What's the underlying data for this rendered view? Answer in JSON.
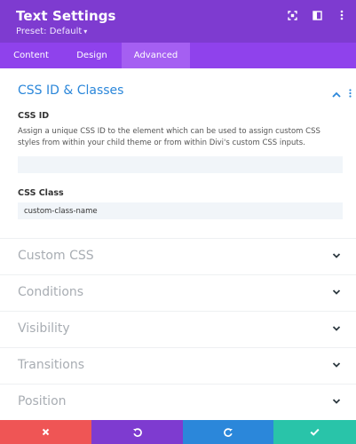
{
  "header": {
    "title": "Text Settings",
    "preset_label": "Preset: Default",
    "icons": [
      "expand-icon",
      "sidebar-toggle-icon",
      "more-options-icon"
    ],
    "color": "#7e3bd0"
  },
  "tabs": [
    {
      "label": "Content",
      "active": false
    },
    {
      "label": "Design",
      "active": false
    },
    {
      "label": "Advanced",
      "active": true
    }
  ],
  "open_section": {
    "title": "CSS ID & Classes",
    "css_id": {
      "label": "CSS ID",
      "description": "Assign a unique CSS ID to the element which can be used to assign custom CSS styles from within your child theme or from within Divi's custom CSS inputs.",
      "value": ""
    },
    "css_class": {
      "label": "CSS Class",
      "value": "custom-class-name"
    }
  },
  "sections": [
    {
      "title": "Custom CSS"
    },
    {
      "title": "Conditions"
    },
    {
      "title": "Visibility"
    },
    {
      "title": "Transitions"
    },
    {
      "title": "Position"
    }
  ],
  "footer": {
    "buttons": [
      {
        "name": "cancel",
        "icon": "close-icon",
        "color": "#ef5555"
      },
      {
        "name": "undo",
        "icon": "undo-icon",
        "color": "#7e3bd0"
      },
      {
        "name": "redo",
        "icon": "redo-icon",
        "color": "#2b87da"
      },
      {
        "name": "save",
        "icon": "check-icon",
        "color": "#29c4a9"
      }
    ]
  },
  "colors": {
    "accent_blue": "#2b87da",
    "tab_bar": "#8f42ec",
    "active_tab": "#a55ff2"
  }
}
